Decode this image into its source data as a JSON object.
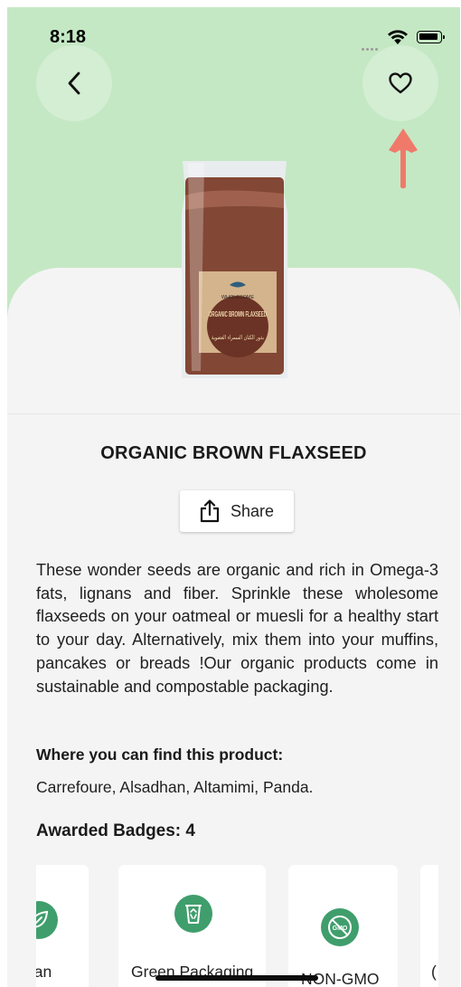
{
  "status_bar": {
    "time": "8:18"
  },
  "product": {
    "title": "ORGANIC BROWN FLAXSEED",
    "package_brand": "WHOLESOME",
    "package_label_en": "ORGANIC BROWN FLAXSEED",
    "package_label_ar": "بذور الكتان السمراء العضوية"
  },
  "share": {
    "label": "Share"
  },
  "description": "These wonder seeds are organic and rich in Omega-3 fats, lignans and fiber. Sprinkle these wholesome flaxseeds on your oatmeal or muesli for a healthy start to your day. Alternatively, mix them into your muffins, pancakes or breads !Our organic products come in sustainable and compostable packaging.",
  "where_to_find": {
    "title": "Where you can find this product:",
    "stores": "Carrefoure, Alsadhan, Altamimi, Panda."
  },
  "badges": {
    "title": "Awarded Badges: 4",
    "items": [
      {
        "label": "gan",
        "icon": "leaf-icon"
      },
      {
        "label": "Green Packaging",
        "icon": "recycle-bin-icon"
      },
      {
        "label": "NON-GMO",
        "icon": "gmo-free-icon"
      },
      {
        "label": "(",
        "icon": "badge-icon"
      }
    ]
  },
  "colors": {
    "hero_bg": "#c5e8c4",
    "badge_green": "#3f9e6c",
    "arrow": "#ef7a6a",
    "page_bg": "#f4f4f4"
  }
}
